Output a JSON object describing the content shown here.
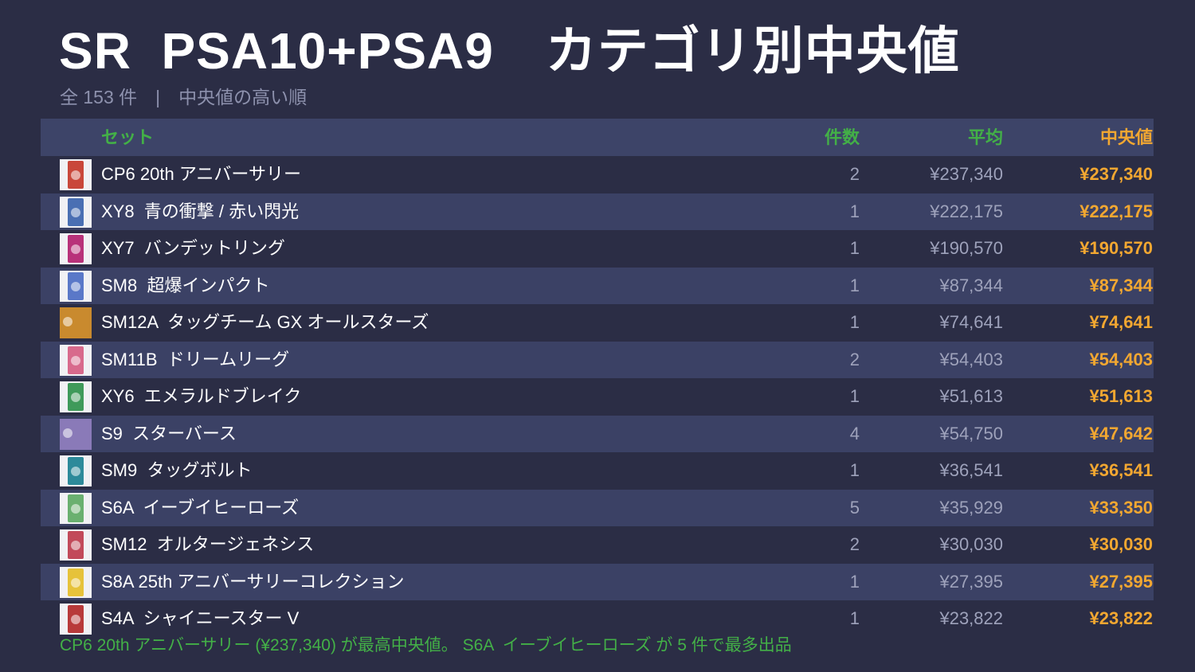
{
  "title": "SR  PSA10+PSA9　カテゴリ別中央値",
  "subtitle": "全 153 件　|　中央値の高い順",
  "headers": {
    "set": "セット",
    "count": "件数",
    "average": "平均",
    "median": "中央値"
  },
  "rows": [
    {
      "name": "CP6 20th アニバーサリー",
      "count": "2",
      "average": "¥237,340",
      "median": "¥237,340",
      "thumb_color": "#c9473a"
    },
    {
      "name": "XY8  青の衝撃 / 赤い閃光",
      "count": "1",
      "average": "¥222,175",
      "median": "¥222,175",
      "thumb_color": "#4a6fb3"
    },
    {
      "name": "XY7  バンデットリング",
      "count": "1",
      "average": "¥190,570",
      "median": "¥190,570",
      "thumb_color": "#b8327a"
    },
    {
      "name": "SM8  超爆インパクト",
      "count": "1",
      "average": "¥87,344",
      "median": "¥87,344",
      "thumb_color": "#5a78c8"
    },
    {
      "name": "SM12A  タッグチーム GX オールスターズ",
      "count": "1",
      "average": "¥74,641",
      "median": "¥74,641",
      "thumb_color": "#c98a2e"
    },
    {
      "name": "SM11B  ドリームリーグ",
      "count": "2",
      "average": "¥54,403",
      "median": "¥54,403",
      "thumb_color": "#d86a8c"
    },
    {
      "name": "XY6  エメラルドブレイク",
      "count": "1",
      "average": "¥51,613",
      "median": "¥51,613",
      "thumb_color": "#3f9a5a"
    },
    {
      "name": "S9  スターバース",
      "count": "4",
      "average": "¥54,750",
      "median": "¥47,642",
      "thumb_color": "#8a7ab8"
    },
    {
      "name": "SM9  タッグボルト",
      "count": "1",
      "average": "¥36,541",
      "median": "¥36,541",
      "thumb_color": "#2d8a9a"
    },
    {
      "name": "S6A  イーブイヒーローズ",
      "count": "5",
      "average": "¥35,929",
      "median": "¥33,350",
      "thumb_color": "#6ab070"
    },
    {
      "name": "SM12  オルタージェネシス",
      "count": "2",
      "average": "¥30,030",
      "median": "¥30,030",
      "thumb_color": "#c24a5a"
    },
    {
      "name": "S8A 25th アニバーサリーコレクション",
      "count": "1",
      "average": "¥27,395",
      "median": "¥27,395",
      "thumb_color": "#e6c23a"
    },
    {
      "name": "S4A  シャイニースター V",
      "count": "1",
      "average": "¥23,822",
      "median": "¥23,822",
      "thumb_color": "#b83a3a"
    }
  ],
  "footer": "CP6 20th アニバーサリー (¥237,340) が最高中央値。 S6A  イーブイヒーローズ が 5 件で最多出品",
  "colors": {
    "background": "#2b2d45",
    "row_alt": "#3b4165",
    "header_bg": "#3d4468",
    "accent_green": "#43b047",
    "accent_orange": "#f2a731"
  }
}
